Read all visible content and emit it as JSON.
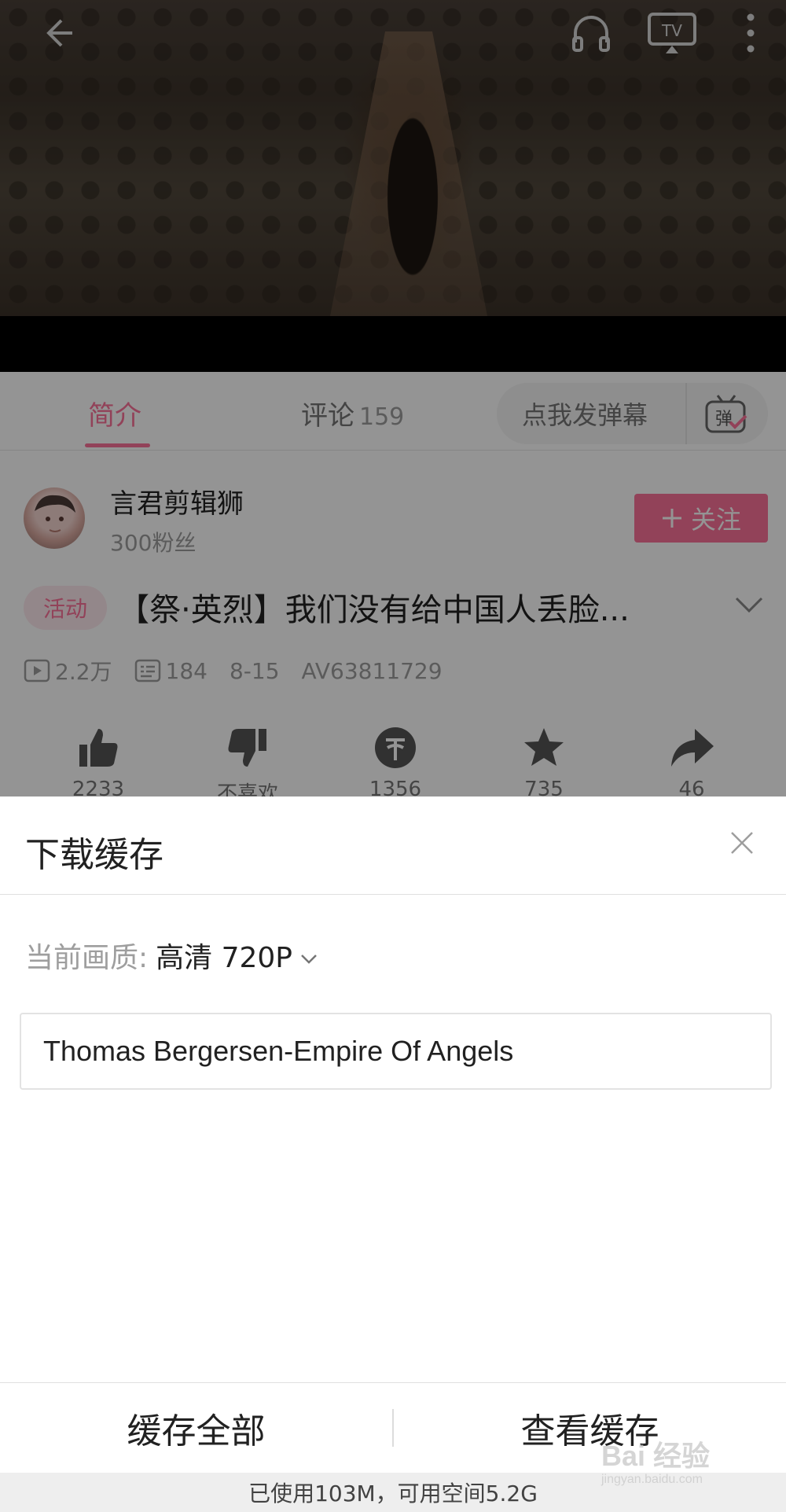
{
  "tabs": {
    "intro_label": "简介",
    "comments_label": "评论",
    "comments_count": "159"
  },
  "danmaku": {
    "label": "点我发弹幕",
    "icon_text": "弹"
  },
  "uploader": {
    "name": "言君剪辑狮",
    "fans": "300粉丝",
    "follow_label": "关注"
  },
  "video": {
    "activity_tag": "活动",
    "title": "【祭·英烈】我们没有给中国人丢脸...",
    "views": "2.2万",
    "danmaku_count": "184",
    "date": "8-15",
    "av_id": "AV63811729"
  },
  "actions": {
    "like_count": "2233",
    "dislike_label": "不喜欢",
    "coin_count": "1356",
    "fav_count": "735",
    "share_count": "46"
  },
  "sheet": {
    "title": "下载缓存",
    "quality_label": "当前画质:",
    "quality_value": "高清 720P",
    "episode_title": "Thomas Bergersen-Empire Of Angels",
    "cache_all_label": "缓存全部",
    "view_cache_label": "查看缓存",
    "storage_text": "已使用103M，可用空间5.2G"
  },
  "watermark": {
    "text": "Bai 经验",
    "sub": "jingyan.baidu.com"
  },
  "colors": {
    "accent": "#fb7299"
  }
}
